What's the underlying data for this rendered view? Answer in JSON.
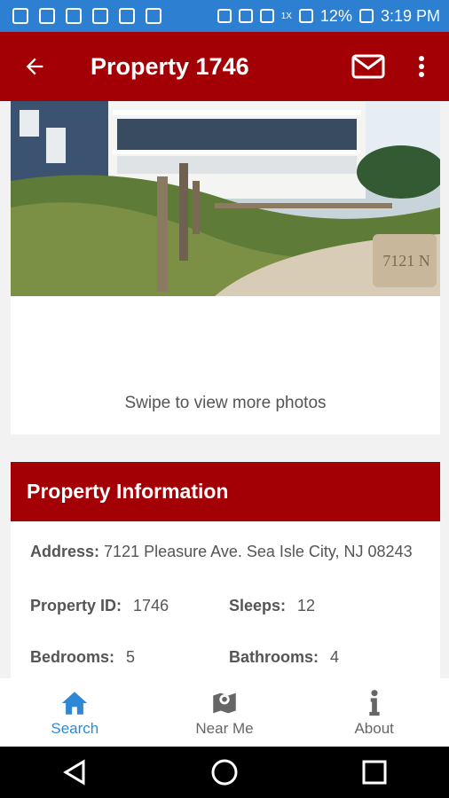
{
  "status_bar": {
    "battery": "12%",
    "time": "3:19 PM",
    "network": "1X"
  },
  "app_bar": {
    "title": "Property 1746",
    "back_icon": "back-arrow-icon",
    "mail_icon": "mail-icon",
    "more_icon": "more-vert-icon"
  },
  "photo": {
    "sign_text": "7121 N",
    "swipe_hint": "Swipe to view more photos"
  },
  "property_info": {
    "heading": "Property Information",
    "address_label": "Address:",
    "address_value": "7121 Pleasure Ave. Sea Isle City, NJ 08243",
    "property_id_label": "Property ID:",
    "property_id_value": "1746",
    "sleeps_label": "Sleeps:",
    "sleeps_value": "12",
    "bedrooms_label": "Bedrooms:",
    "bedrooms_value": "5",
    "bathrooms_label": "Bathrooms:",
    "bathrooms_value": "4"
  },
  "tabs": [
    {
      "label": "Search",
      "icon": "home-icon",
      "active": true
    },
    {
      "label": "Near Me",
      "icon": "map-pin-icon",
      "active": false
    },
    {
      "label": "About",
      "icon": "info-icon",
      "active": false
    }
  ],
  "colors": {
    "status_bar": "#2d7fd1",
    "app_bar": "#a30005",
    "active_tab": "#2f88d6"
  }
}
